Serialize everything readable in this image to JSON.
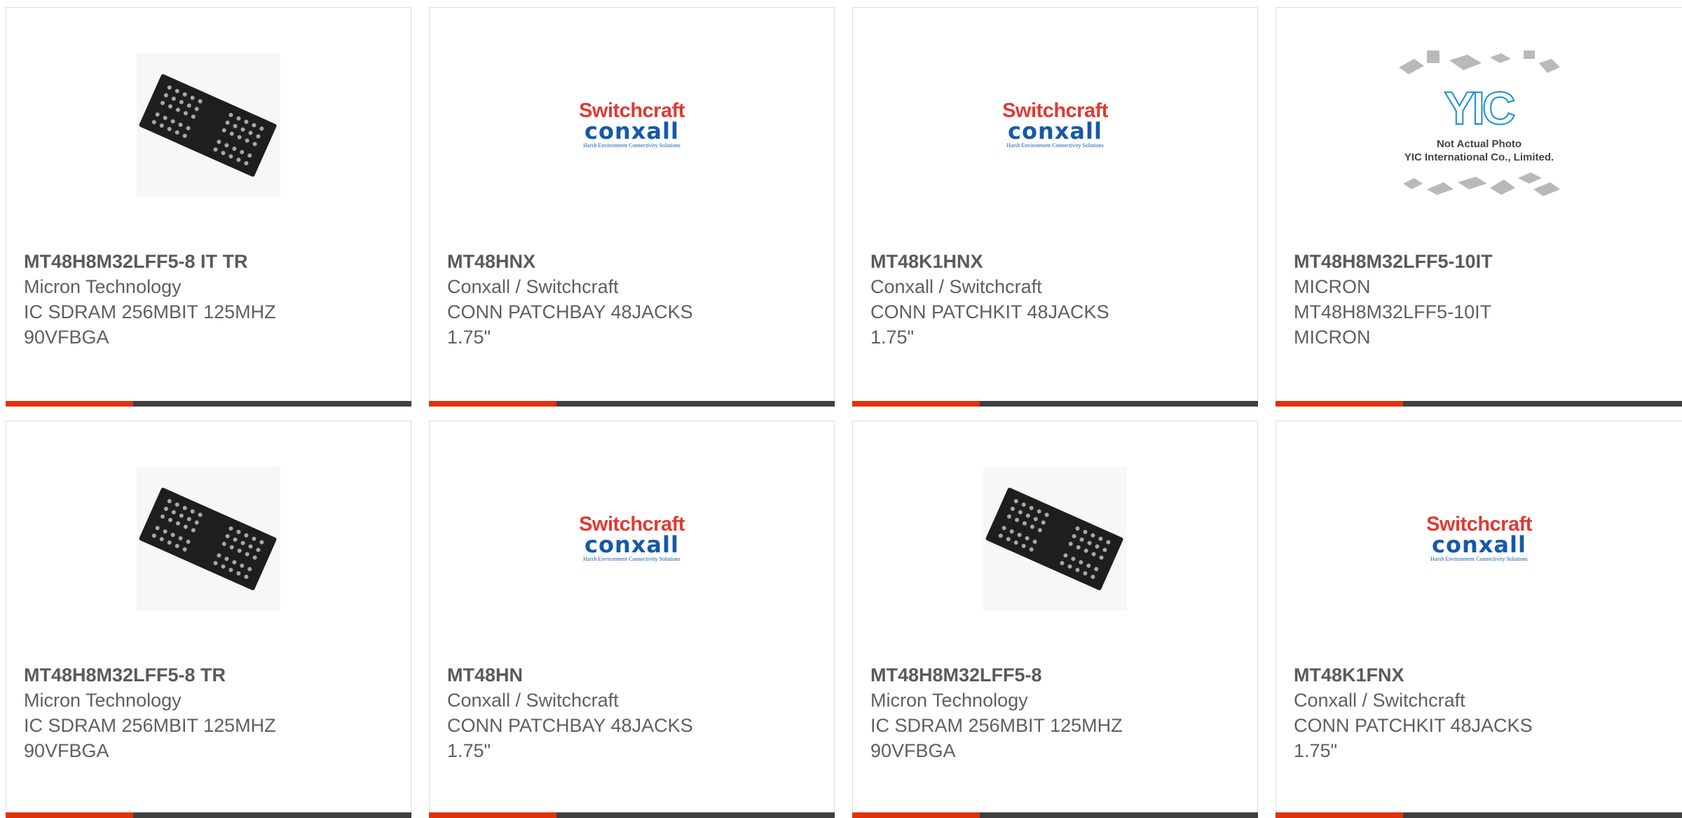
{
  "products": [
    {
      "part_number": "MT48H8M32LFF5-8 IT TR",
      "manufacturer": "Micron Technology",
      "description": [
        "IC SDRAM 256MBIT 125MHZ",
        "90VFBGA"
      ],
      "image": "chip-icon"
    },
    {
      "part_number": "MT48HNX",
      "manufacturer": "Conxall / Switchcraft",
      "description": [
        "CONN PATCHBAY 48JACKS",
        "1.75\""
      ],
      "image": "switchcraft-logo"
    },
    {
      "part_number": "MT48K1HNX",
      "manufacturer": "Conxall / Switchcraft",
      "description": [
        "CONN PATCHKIT 48JACKS",
        "1.75\""
      ],
      "image": "switchcraft-logo"
    },
    {
      "part_number": "MT48H8M32LFF5-10IT",
      "manufacturer": "MICRON",
      "description": [
        "MT48H8M32LFF5-10IT",
        "MICRON"
      ],
      "image": "placeholder-photo"
    },
    {
      "part_number": "MT48H8M32LFF5-8 TR",
      "manufacturer": "Micron Technology",
      "description": [
        "IC SDRAM 256MBIT 125MHZ",
        "90VFBGA"
      ],
      "image": "chip-icon"
    },
    {
      "part_number": "MT48HN",
      "manufacturer": "Conxall / Switchcraft",
      "description": [
        "CONN PATCHBAY 48JACKS",
        "1.75\""
      ],
      "image": "switchcraft-logo"
    },
    {
      "part_number": "MT48H8M32LFF5-8",
      "manufacturer": "Micron Technology",
      "description": [
        "IC SDRAM 256MBIT 125MHZ",
        "90VFBGA"
      ],
      "image": "chip-icon"
    },
    {
      "part_number": "MT48K1FNX",
      "manufacturer": "Conxall / Switchcraft",
      "description": [
        "CONN PATCHKIT 48JACKS",
        "1.75\""
      ],
      "image": "switchcraft-logo"
    }
  ],
  "logo": {
    "line1": "Switchcraft",
    "line2": "conxall",
    "line3": "Harsh Environment Connectivity Solutions"
  },
  "placeholder": {
    "line1": "Not Actual Photo",
    "line2": "YIC International Co., Limited.",
    "mark": "YIC"
  },
  "colors": {
    "accent": "#e2320c",
    "bar": "#3f3f3f",
    "border": "#dcdcdc",
    "text": "#5f5f5f"
  }
}
